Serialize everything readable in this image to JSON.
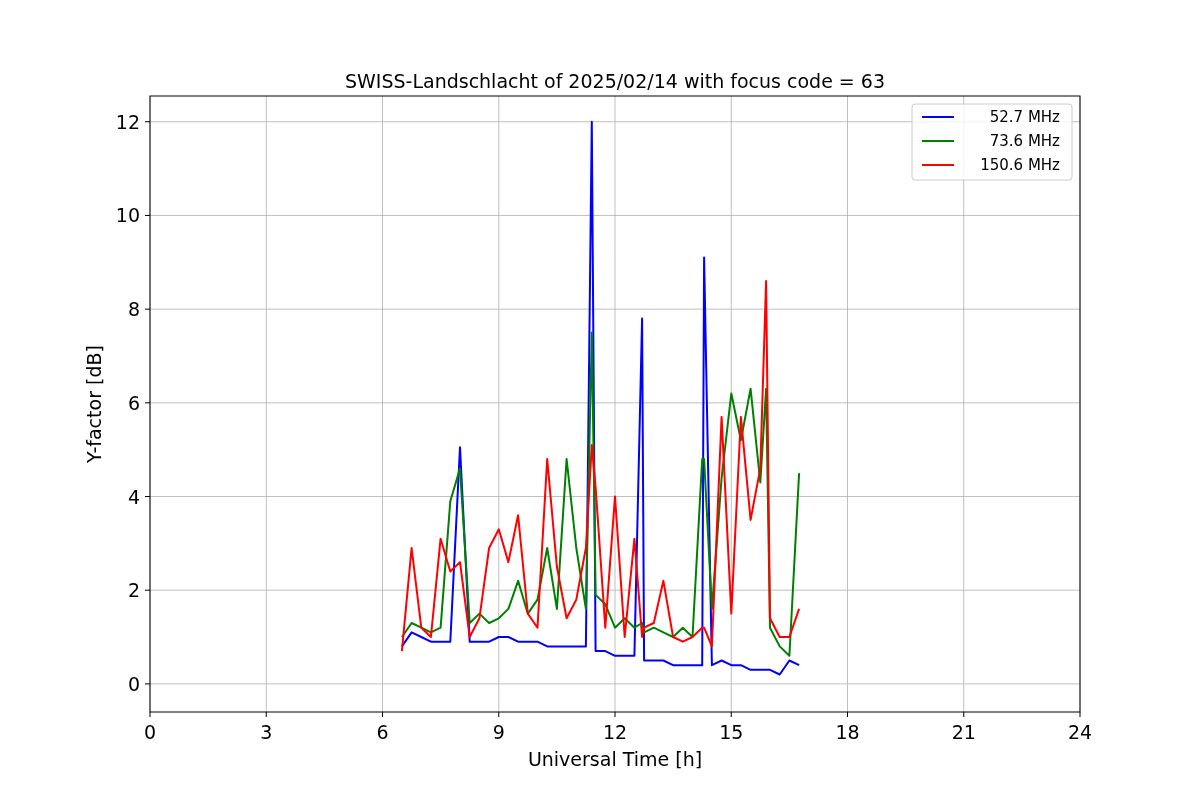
{
  "chart_data": {
    "type": "line",
    "title": "SWISS-Landschlacht of 2025/02/14 with focus code = 63",
    "xlabel": "Universal Time [h]",
    "ylabel": "Y-factor [dB]",
    "x": [
      6.5,
      6.75,
      7,
      7.25,
      7.5,
      7.75,
      8,
      8.25,
      8.5,
      8.75,
      9,
      9.25,
      9.5,
      9.75,
      10,
      10.25,
      10.5,
      10.75,
      11,
      11.25,
      11.4,
      11.5,
      11.75,
      12,
      12.25,
      12.5,
      12.7,
      12.75,
      13,
      13.25,
      13.5,
      13.75,
      14,
      14.25,
      14.3,
      14.5,
      14.75,
      15,
      15.25,
      15.5,
      15.75,
      15.9,
      16,
      16.25,
      16.5,
      16.75
    ],
    "series": [
      {
        "name": "52.7 MHz",
        "color": "#0000ff",
        "values": [
          0.8,
          1.1,
          1.0,
          0.9,
          0.9,
          0.9,
          5.05,
          0.9,
          0.9,
          0.9,
          1.0,
          1.0,
          0.9,
          0.9,
          0.9,
          0.8,
          0.8,
          0.8,
          0.8,
          0.8,
          12.0,
          0.7,
          0.7,
          0.6,
          0.6,
          0.6,
          7.8,
          0.5,
          0.5,
          0.5,
          0.4,
          0.4,
          0.4,
          0.4,
          9.1,
          0.4,
          0.5,
          0.4,
          0.4,
          0.3,
          0.3,
          0.3,
          0.3,
          0.2,
          0.5,
          0.4
        ]
      },
      {
        "name": "73.6 MHz",
        "color": "#008000",
        "values": [
          1.0,
          1.3,
          1.2,
          1.1,
          1.2,
          3.9,
          4.6,
          1.3,
          1.5,
          1.3,
          1.4,
          1.6,
          2.2,
          1.5,
          1.8,
          2.9,
          1.6,
          4.8,
          2.9,
          1.6,
          7.5,
          1.9,
          1.7,
          1.2,
          1.4,
          1.2,
          1.3,
          1.1,
          1.2,
          1.1,
          1.0,
          1.2,
          1.0,
          4.8,
          4.8,
          1.6,
          4.4,
          6.2,
          5.2,
          6.3,
          4.3,
          6.3,
          1.2,
          0.8,
          0.6,
          4.5
        ]
      },
      {
        "name": "150.6 MHz",
        "color": "#ff0000",
        "values": [
          0.7,
          2.9,
          1.2,
          1.0,
          3.1,
          2.4,
          2.6,
          1.0,
          1.4,
          2.9,
          3.3,
          2.6,
          3.6,
          1.5,
          1.2,
          4.8,
          2.5,
          1.4,
          1.8,
          2.9,
          5.1,
          4.2,
          1.2,
          4.0,
          1.0,
          3.1,
          1.0,
          1.2,
          1.3,
          2.2,
          1.0,
          0.9,
          1.0,
          1.2,
          1.2,
          0.8,
          5.7,
          1.5,
          5.7,
          3.5,
          4.6,
          8.6,
          1.4,
          1.0,
          1.0,
          1.6
        ]
      }
    ],
    "grid": true,
    "legend": true,
    "xlim": [
      0,
      24
    ],
    "ylim": [
      -0.6,
      12.55
    ],
    "xticks": [
      0,
      3,
      6,
      9,
      12,
      15,
      18,
      21,
      24
    ],
    "yticks": [
      0,
      2,
      4,
      6,
      8,
      10,
      12
    ]
  }
}
